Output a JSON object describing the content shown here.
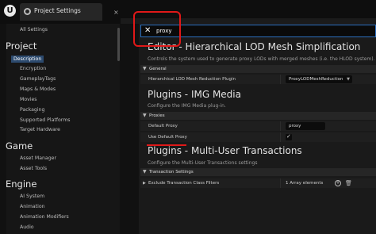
{
  "window": {
    "tab_title": "Project Settings",
    "tab_close": "×"
  },
  "sidebar": {
    "all_settings": "All Settings",
    "sections": [
      {
        "title": "Project",
        "items": [
          "Description",
          "Encryption",
          "GameplayTags",
          "Maps & Modes",
          "Movies",
          "Packaging",
          "Supported Platforms",
          "Target Hardware"
        ]
      },
      {
        "title": "Game",
        "items": [
          "Asset Manager",
          "Asset Tools"
        ]
      },
      {
        "title": "Engine",
        "items": [
          "AI System",
          "Animation",
          "Animation Modifiers",
          "Audio"
        ]
      }
    ],
    "active_item": "Description"
  },
  "search": {
    "value": "proxy",
    "clear_glyph": "✕"
  },
  "main": {
    "sections": [
      {
        "title": "Editor - Hierarchical LOD Mesh Simplification",
        "description": "Controls the system used to generate proxy LODs with merged meshes (i.e. the HLOD system)."
      },
      {
        "title": "Plugins - IMG Media",
        "description": "Configure the IMG Media plug-in."
      },
      {
        "title": "Plugins - Multi-User Transactions",
        "description": "Configure the Multi-User Transactions settings"
      }
    ],
    "categories": {
      "general": "General",
      "proxies": "Proxies",
      "transaction_settings": "Transaction Settings"
    },
    "rows": {
      "hlod_plugin_label": "Hierarchical LOD Mesh Reduction Plugin",
      "hlod_plugin_value": "ProxyLODMeshReduction",
      "default_proxy_label": "Default Proxy",
      "default_proxy_value": "proxy",
      "use_default_proxy_label": "Use Default Proxy",
      "use_default_proxy_checked": true,
      "exclude_filters_label": "Exclude Transaction Class Filters",
      "exclude_filters_value": "1 Array elements"
    }
  },
  "colors": {
    "highlight_red": "#e01818",
    "accent_blue": "#2c6fbf",
    "selected_bg": "#2c4a6e"
  }
}
